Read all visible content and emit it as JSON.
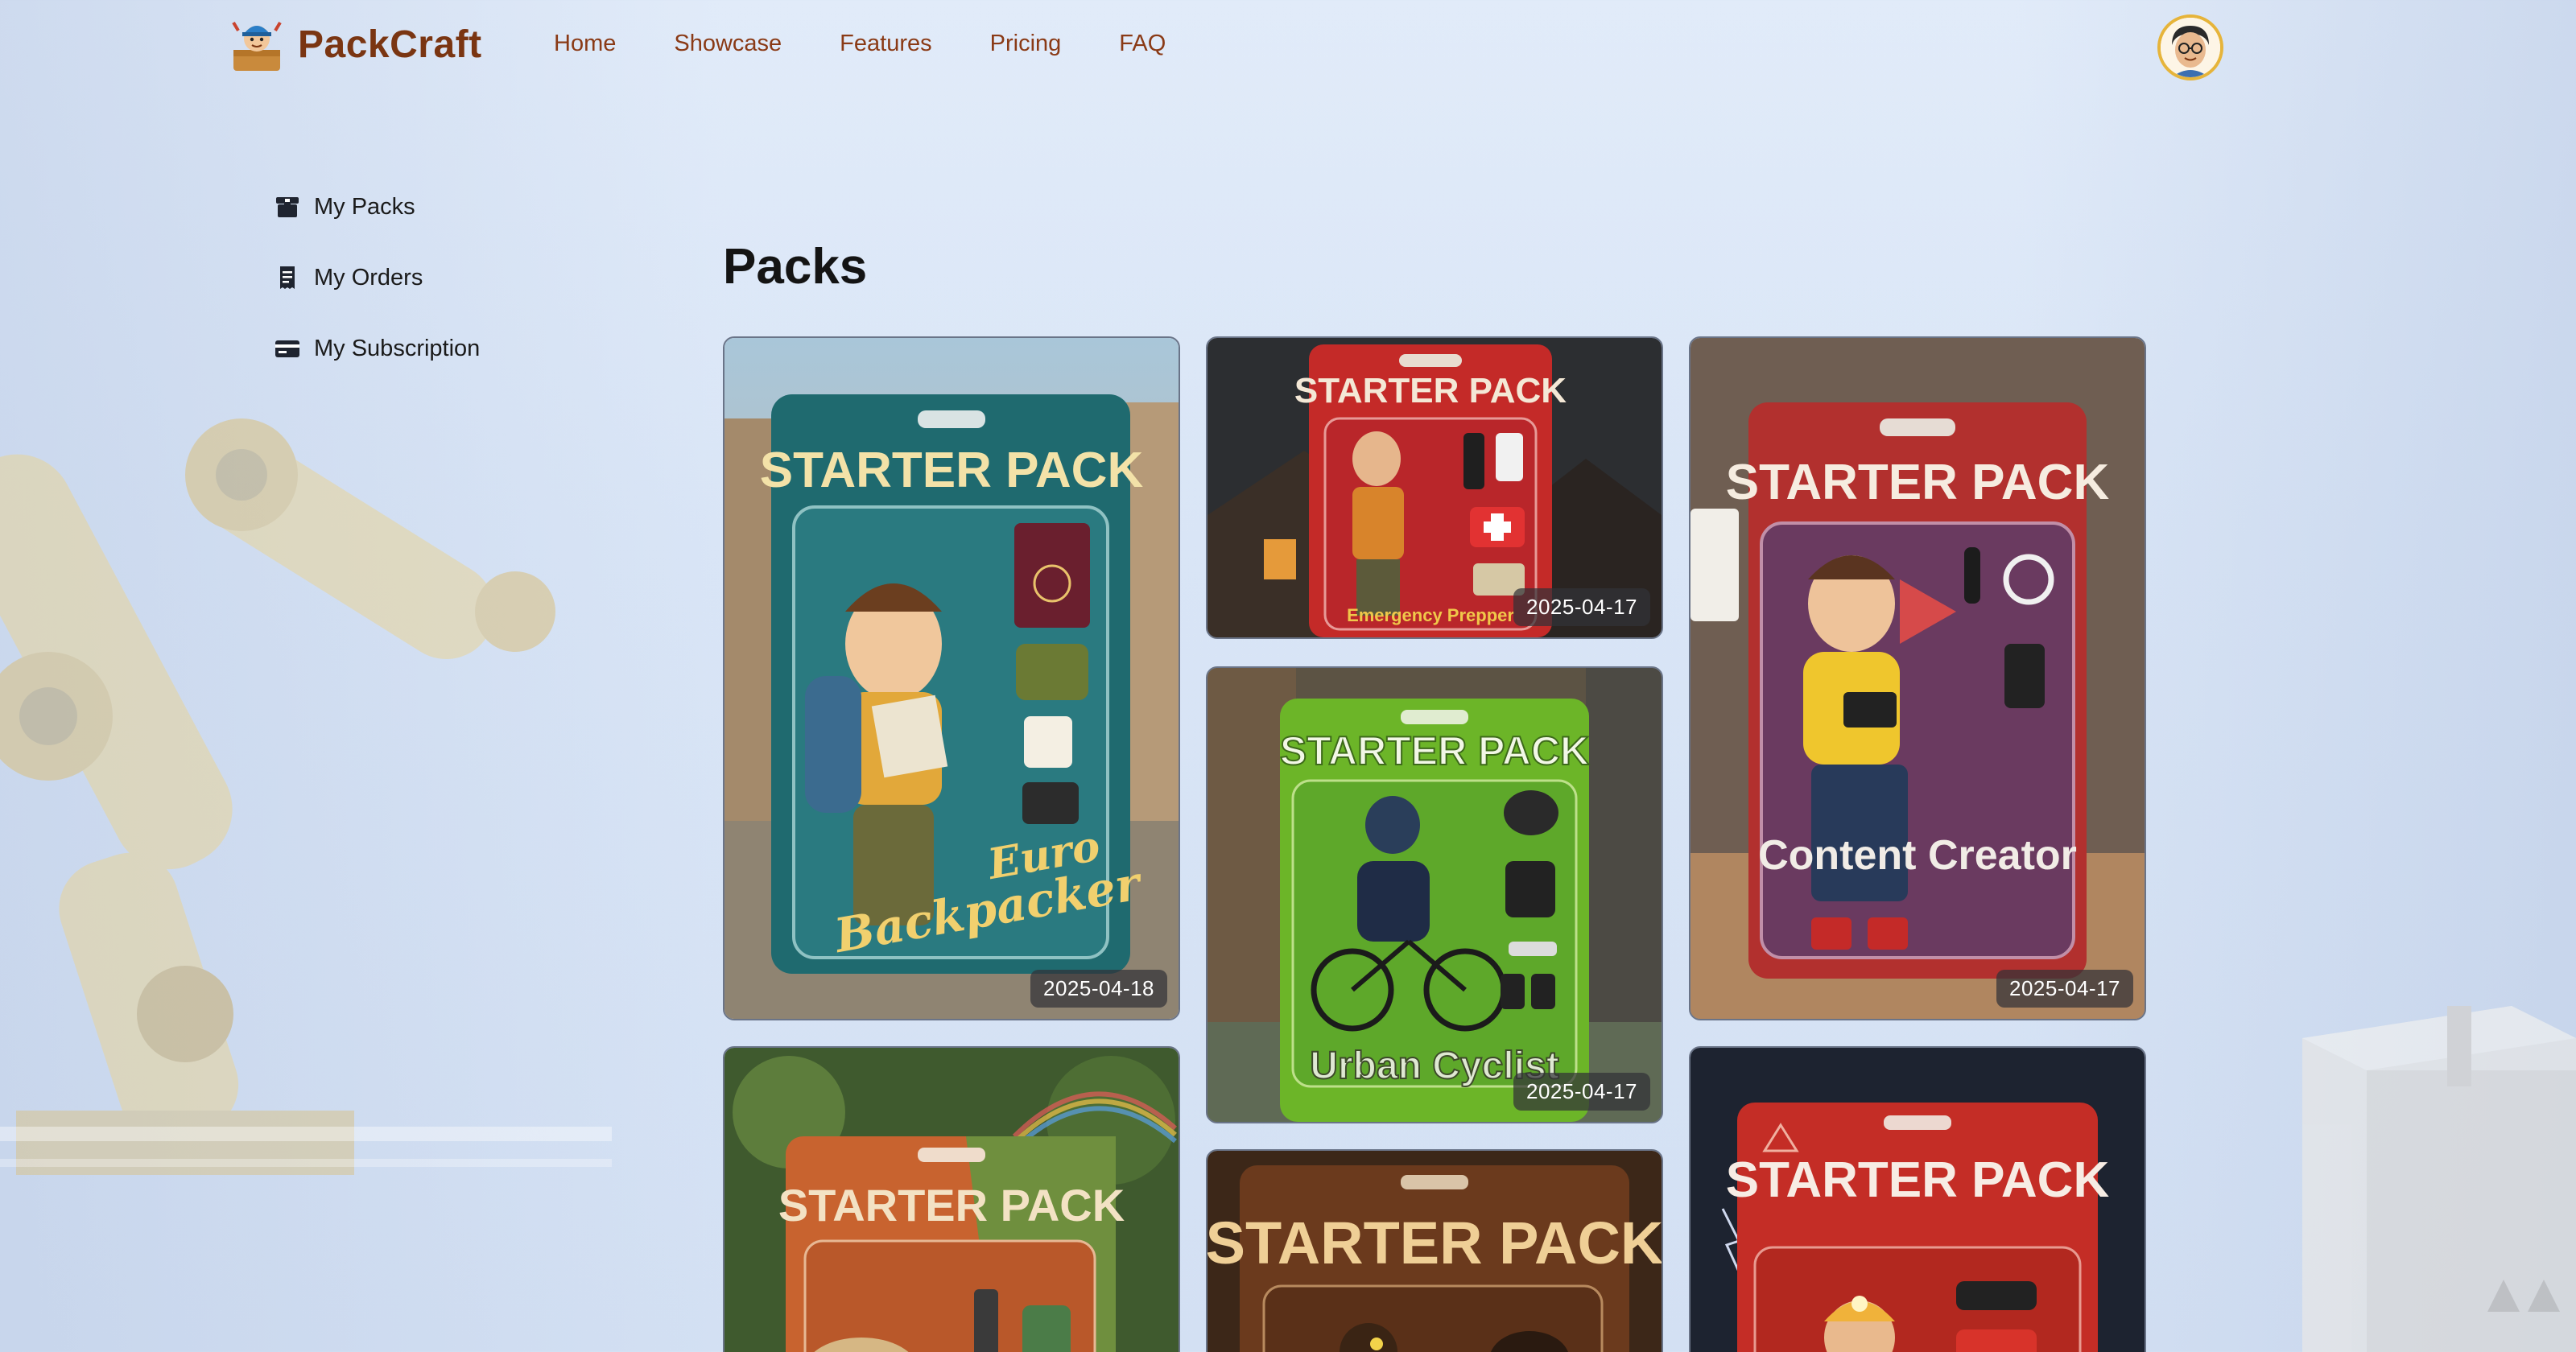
{
  "brand": {
    "name": "PackCraft"
  },
  "nav": {
    "items": [
      "Home",
      "Showcase",
      "Features",
      "Pricing",
      "FAQ"
    ]
  },
  "sidebar": {
    "items": [
      {
        "label": "My Packs",
        "icon": "box-icon"
      },
      {
        "label": "My Orders",
        "icon": "receipt-icon"
      },
      {
        "label": "My Subscription",
        "icon": "credit-card-icon"
      }
    ]
  },
  "main": {
    "title": "Packs",
    "cards": [
      {
        "header": "STARTER PACK",
        "subtitle": "Euro Backpacker",
        "date": "2025-04-18",
        "color": "#1f6a6f"
      },
      {
        "header": "STARTER PACK",
        "subtitle": "Emergency Prepper",
        "date": "2025-04-17",
        "color": "#c42a28"
      },
      {
        "header": "STARTER PACK",
        "subtitle": "Content Creator",
        "date": "2025-04-17",
        "color": "#b2302e"
      },
      {
        "header": "STARTER PACK",
        "subtitle": "Urban Cyclist",
        "date": "2025-04-17",
        "color": "#6cb528"
      },
      {
        "header": "STARTER PACK",
        "subtitle": "",
        "date": "",
        "color": "#c8632f"
      },
      {
        "header": "STARTER PACK",
        "subtitle": "",
        "date": "",
        "color": "#6b3a1d"
      },
      {
        "header": "STARTER PACK",
        "subtitle": "",
        "date": "",
        "color": "#c42d26"
      }
    ]
  },
  "colors": {
    "brand": "#7a3512",
    "nav": "#8a3a16",
    "avatar_ring": "#e6b43a"
  }
}
